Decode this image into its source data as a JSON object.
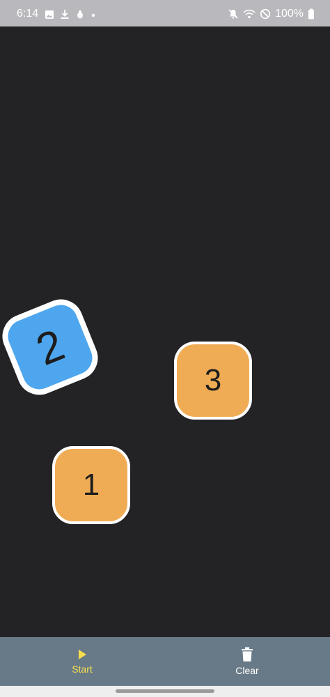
{
  "status_bar": {
    "time": "6:14",
    "battery": "100%",
    "left_icons": [
      "image-icon",
      "download-icon",
      "bug-icon",
      "dot-icon"
    ],
    "right_icons": [
      "mute-icon",
      "wifi-icon",
      "do-not-disturb-icon",
      "battery-icon"
    ]
  },
  "canvas": {
    "background": "#232225",
    "tiles": [
      {
        "label": "1",
        "color": "#f0ac55"
      },
      {
        "label": "2",
        "color": "#4ea7ee"
      },
      {
        "label": "3",
        "color": "#f0ac55"
      }
    ]
  },
  "bottom_nav": {
    "start_label": "Start",
    "clear_label": "Clear",
    "start_color": "#f5df4d",
    "background": "#687a87"
  }
}
